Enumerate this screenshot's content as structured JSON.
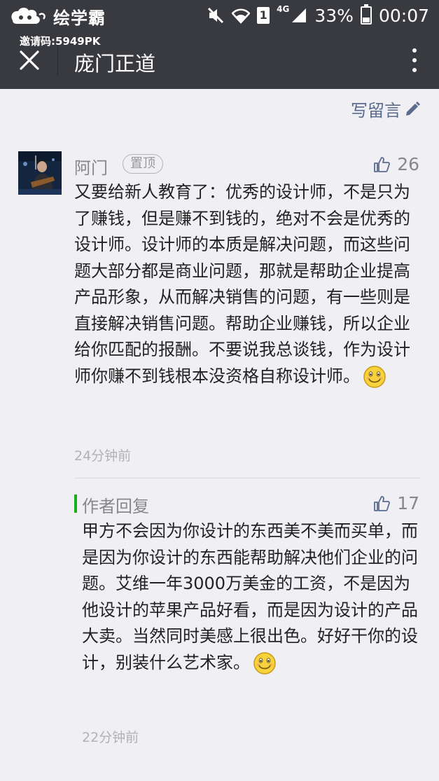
{
  "status_bar": {
    "brand": "绘学霸",
    "invite_code": "邀请码:5949PK",
    "network": "4G",
    "sim_slot": "1",
    "battery_percent": "33%",
    "battery_level": 0.33,
    "time": "00:07"
  },
  "header": {
    "title": "庞门正道",
    "close_icon": "close-icon",
    "more_icon": "more-vertical-icon"
  },
  "write_comment": {
    "label": "写留言",
    "icon": "pencil-icon"
  },
  "comment": {
    "author": "阿门",
    "pin_badge": "置顶",
    "likes": "26",
    "text": "又要给新人教育了：优秀的设计师，不是只为了赚钱，但是赚不到钱的，绝对不会是优秀的设计师。设计师的本质是解决问题，而这些问题大部分都是商业问题，那就是帮助企业提高产品形象，从而解决销售的问题，有一些则是直接解决销售问题。帮助企业赚钱，所以企业给你匹配的报酬。不要说我总谈钱，作为设计师你赚不到钱根本没资格自称设计师。",
    "time": "24分钟前"
  },
  "reply": {
    "label": "作者回复",
    "likes": "17",
    "text": "甲方不会因为你设计的东西美不美而买单，而是因为你设计的东西能帮助解决他们企业的问题。艾维一年3000万美金的工资，不是因为他设计的苹果产品好看，而是因为设计的产品大卖。当然同时美感上很出色。好好干你的设计，别装什么艺术家。",
    "time": "22分钟前"
  },
  "colors": {
    "title_bar": "#393a3f",
    "background": "#efeff4",
    "link": "#5b6b8d",
    "reply_accent": "#1aad19"
  }
}
